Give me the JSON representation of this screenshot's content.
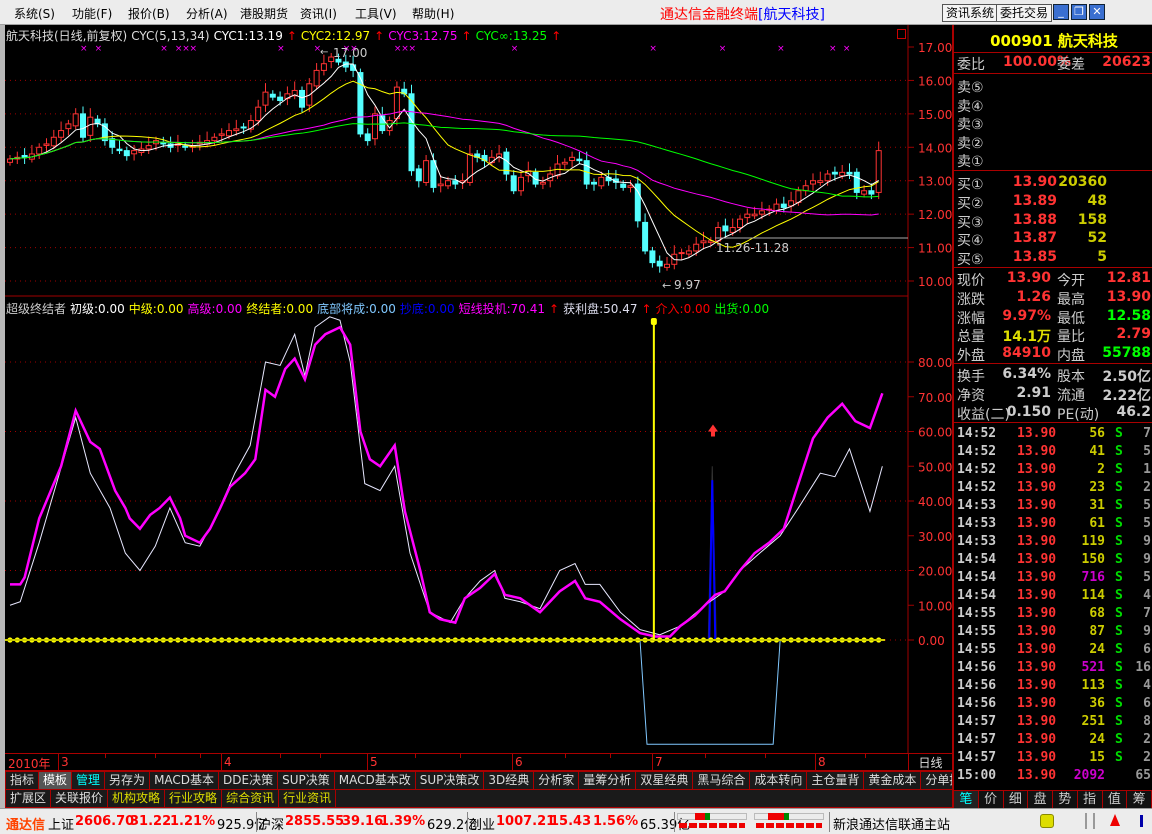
{
  "menu": [
    "系统(S)",
    "功能(F)",
    "报价(B)",
    "分析(A)",
    "港股期货",
    "资讯(I)",
    "工具(V)",
    "帮助(H)"
  ],
  "app_title": {
    "prefix": "通达信金融终端",
    "stock": "[航天科技]"
  },
  "window_buttons": {
    "info": "资讯系统",
    "trade": "委托交易",
    "minimize": "_",
    "restore": "❐",
    "close": "✕"
  },
  "price_legend": {
    "name": "航天科技(日线,前复权)",
    "indicator": "CYC(5,13,34)",
    "cyc1": "CYC1:13.19",
    "cyc2": "CYC2:12.97",
    "cyc3": "CYC3:12.75",
    "cycinf": "CYC∞:13.25",
    "arrow": "↑"
  },
  "ind_legend": {
    "name": "超级终结者",
    "chuji": "初级:0.00",
    "zhongji": "中级:0.00",
    "gaoji": "高级:0.00",
    "zhongjiezhe": "终结者:0.00",
    "dibu": "底部将成:0.00",
    "chaodi": "抄底:0.00",
    "duanxian": "短线投机:70.41",
    "huoli": "获利盘:50.47",
    "jieru": "介入:0.00",
    "chuhuo": "出货:0.00",
    "arrow": "↑"
  },
  "colors": {
    "up": "#ff3333",
    "down": "#54ffff",
    "ma5": "#ffffff",
    "ma13": "#ffff00",
    "ma34": "#ff00ff",
    "malong": "#00ff00",
    "grid": "#a00000"
  },
  "chart_data": [
    {
      "type": "candlestick",
      "title": "航天科技(日线,前复权)",
      "ylim": [
        10,
        17
      ],
      "yticks": [
        "17.00",
        "16.00",
        "15.00",
        "14.00",
        "13.00",
        "12.00",
        "11.00",
        "10.00"
      ],
      "closes": [
        13.65,
        13.7,
        13.7,
        13.8,
        14.0,
        14.1,
        14.3,
        14.5,
        14.7,
        15.0,
        14.3,
        14.9,
        14.7,
        14.2,
        14.0,
        13.9,
        13.75,
        13.9,
        13.95,
        14.05,
        14.2,
        14.1,
        14.0,
        14.1,
        14.0,
        14.05,
        14.15,
        14.2,
        14.3,
        14.4,
        14.5,
        14.55,
        14.6,
        14.8,
        15.2,
        15.65,
        15.5,
        15.4,
        15.6,
        15.7,
        15.2,
        15.9,
        16.3,
        16.5,
        16.7,
        16.55,
        16.4,
        16.3,
        14.4,
        14.2,
        15.0,
        14.5,
        14.8,
        15.8,
        15.6,
        13.3,
        13.0,
        13.6,
        12.8,
        12.9,
        13.0,
        12.9,
        13.0,
        13.8,
        13.7,
        13.6,
        13.7,
        13.8,
        13.2,
        12.7,
        13.1,
        13.3,
        12.9,
        12.95,
        13.2,
        13.5,
        13.55,
        13.7,
        13.6,
        12.9,
        12.9,
        13.1,
        13.0,
        12.95,
        12.8,
        12.85,
        11.8,
        10.9,
        10.55,
        10.45,
        10.5,
        10.8,
        10.85,
        10.9,
        11.1,
        11.2,
        11.2,
        11.6,
        11.5,
        11.6,
        11.85,
        12.0,
        12.0,
        12.1,
        12.15,
        12.3,
        12.2,
        12.4,
        12.7,
        12.85,
        13.0,
        13.0,
        13.2,
        13.2,
        13.25,
        13.2,
        12.65,
        12.7,
        12.6,
        13.9
      ],
      "ma_periods": [
        5,
        13,
        34,
        60
      ],
      "markers": [
        10,
        12,
        21,
        23,
        24,
        25,
        37,
        42,
        46,
        47,
        53,
        54,
        55,
        69,
        88,
        97.5,
        105.5,
        112.6,
        114.5
      ],
      "annotations": {
        "high": "17.00",
        "low": "9.97",
        "range": "11.26-11.28"
      }
    },
    {
      "type": "line",
      "title": "超级终结者",
      "ylim": [
        -32,
        95
      ],
      "yticks": [
        "80.00",
        "70.00",
        "60.00",
        "50.00",
        "40.00",
        "30.00",
        "20.00",
        "10.00",
        "0.00"
      ],
      "series": [
        {
          "name": "短线投机",
          "color": "#ff00ff",
          "points": [
            [
              0,
              16
            ],
            [
              1.4,
              16
            ],
            [
              2,
              18
            ],
            [
              4,
              35
            ],
            [
              7,
              50
            ],
            [
              9,
              66
            ],
            [
              11,
              57
            ],
            [
              12.3,
              55
            ],
            [
              14.4,
              43
            ],
            [
              15.8,
              38
            ],
            [
              16.4,
              35
            ],
            [
              17.8,
              32
            ],
            [
              19.2,
              36
            ],
            [
              20.5,
              38
            ],
            [
              21.9,
              41
            ],
            [
              23.3,
              35
            ],
            [
              24,
              30
            ],
            [
              26,
              28
            ],
            [
              27.4,
              32
            ],
            [
              28.8,
              38
            ],
            [
              30.1,
              44
            ],
            [
              32.2,
              48
            ],
            [
              33.6,
              52
            ],
            [
              35,
              72
            ],
            [
              36.3,
              70
            ],
            [
              37.7,
              78
            ],
            [
              39,
              81
            ],
            [
              40.4,
              75
            ],
            [
              41.8,
              85
            ],
            [
              43.2,
              88
            ],
            [
              45.2,
              90
            ],
            [
              46.6,
              85
            ],
            [
              48,
              60
            ],
            [
              49.3,
              52
            ],
            [
              50.7,
              50
            ],
            [
              52.7,
              56
            ],
            [
              54.1,
              37
            ],
            [
              56.2,
              20
            ],
            [
              57.5,
              8
            ],
            [
              58.9,
              6
            ],
            [
              61,
              5
            ],
            [
              62.3,
              12
            ],
            [
              64.4,
              15
            ],
            [
              66.4,
              19
            ],
            [
              67.8,
              13
            ],
            [
              69.9,
              12
            ],
            [
              72.6,
              8
            ],
            [
              75.3,
              14
            ],
            [
              77.4,
              17
            ],
            [
              78.8,
              12
            ],
            [
              80.8,
              11
            ],
            [
              83.6,
              6
            ],
            [
              86.3,
              2
            ],
            [
              88.4,
              1
            ],
            [
              90.4,
              1
            ],
            [
              91.8,
              4
            ],
            [
              93.8,
              7
            ],
            [
              95.2,
              10
            ],
            [
              96.6,
              13
            ],
            [
              97.9,
              14
            ],
            [
              100,
              20
            ],
            [
              102,
              25
            ],
            [
              104,
              28
            ],
            [
              106,
              32
            ],
            [
              108,
              45
            ],
            [
              110,
              58
            ],
            [
              112,
              64
            ],
            [
              114,
              68
            ],
            [
              115.8,
              63
            ],
            [
              117.8,
              61
            ],
            [
              119.5,
              71
            ]
          ]
        },
        {
          "name": "获利盘",
          "color": "#e8e8ff",
          "points": [
            [
              0,
              10
            ],
            [
              1.4,
              11
            ],
            [
              4,
              28
            ],
            [
              9,
              64
            ],
            [
              11,
              48
            ],
            [
              13.7,
              38
            ],
            [
              15.8,
              25
            ],
            [
              17.8,
              20
            ],
            [
              19.9,
              27
            ],
            [
              21.9,
              38
            ],
            [
              24,
              28
            ],
            [
              26,
              27
            ],
            [
              28.1,
              35
            ],
            [
              30.8,
              48
            ],
            [
              32.9,
              56
            ],
            [
              35,
              80
            ],
            [
              37,
              79
            ],
            [
              39,
              88
            ],
            [
              40.4,
              76
            ],
            [
              41.8,
              90
            ],
            [
              43.8,
              93
            ],
            [
              45.2,
              92
            ],
            [
              46.6,
              80
            ],
            [
              48.6,
              45
            ],
            [
              50.7,
              43
            ],
            [
              52.7,
              50
            ],
            [
              54.8,
              25
            ],
            [
              57.5,
              8
            ],
            [
              60.3,
              5
            ],
            [
              62.3,
              12
            ],
            [
              64.4,
              17
            ],
            [
              66.4,
              20
            ],
            [
              67.8,
              12
            ],
            [
              69.9,
              11
            ],
            [
              72.6,
              9
            ],
            [
              75.3,
              20
            ],
            [
              77.4,
              22
            ],
            [
              78.8,
              16
            ],
            [
              80.8,
              16
            ],
            [
              83.6,
              8
            ],
            [
              86.3,
              3
            ],
            [
              89,
              1.5
            ],
            [
              91.8,
              4
            ],
            [
              95.2,
              10
            ],
            [
              97.9,
              14
            ],
            [
              100,
              20
            ],
            [
              102.7,
              25
            ],
            [
              105.5,
              30
            ],
            [
              108,
              38
            ],
            [
              111,
              48
            ],
            [
              113,
              47
            ],
            [
              115,
              55
            ],
            [
              116.4,
              46
            ],
            [
              117.8,
              37
            ],
            [
              119.5,
              50
            ]
          ]
        }
      ],
      "signal_line_index": 88.2,
      "box": {
        "from": 86.3,
        "to": 105.5,
        "bottom": -30
      },
      "spike": {
        "index": 96.2,
        "value": 46
      },
      "arrow": {
        "index": 96.3,
        "value": 60
      }
    }
  ],
  "date_axis": {
    "year": "2010年",
    "months": [
      "3",
      "4",
      "5",
      "6",
      "7",
      "8"
    ],
    "period": "日线"
  },
  "quote": {
    "code_name": "000901 航天科技",
    "weibi_label": "委比",
    "weibi": "100.00%",
    "weicha_label": "委差",
    "weicha": "20623",
    "sell": [
      {
        "label": "卖⑤"
      },
      {
        "label": "卖④"
      },
      {
        "label": "卖③"
      },
      {
        "label": "卖②"
      },
      {
        "label": "卖①"
      }
    ],
    "buy": [
      {
        "label": "买①",
        "price": "13.90",
        "vol": "20360"
      },
      {
        "label": "买②",
        "price": "13.89",
        "vol": "48"
      },
      {
        "label": "买③",
        "price": "13.88",
        "vol": "158"
      },
      {
        "label": "买④",
        "price": "13.87",
        "vol": "52"
      },
      {
        "label": "买⑤",
        "price": "13.85",
        "vol": "5"
      }
    ],
    "stats": [
      {
        "l1": "现价",
        "v1": "13.90",
        "c1": "#ff3333",
        "l2": "今开",
        "v2": "12.81",
        "c2": "#ff3333"
      },
      {
        "l1": "涨跌",
        "v1": "1.26",
        "c1": "#ff3333",
        "l2": "最高",
        "v2": "13.90",
        "c2": "#ff3333"
      },
      {
        "l1": "涨幅",
        "v1": "9.97%",
        "c1": "#ff3333",
        "l2": "最低",
        "v2": "12.58",
        "c2": "#00ff00"
      },
      {
        "l1": "总量",
        "v1": "14.1万",
        "c1": "#e0e000",
        "l2": "量比",
        "v2": "2.79",
        "c2": "#ff3333"
      },
      {
        "l1": "外盘",
        "v1": "84910",
        "c1": "#ff3333",
        "l2": "内盘",
        "v2": "55788",
        "c2": "#00ff00"
      }
    ],
    "fin": [
      {
        "l1": "换手",
        "v1": "6.34%",
        "l2": "股本",
        "v2": "2.50亿"
      },
      {
        "l1": "净资",
        "v1": "2.91",
        "l2": "流通",
        "v2": "2.22亿"
      },
      {
        "l1": "收益(二)",
        "v1": "0.150",
        "l2": "PE(动)",
        "v2": "46.2"
      }
    ]
  },
  "ticks": [
    {
      "t": "14:52",
      "p": "13.90",
      "v": "56",
      "s": "S",
      "n": "7"
    },
    {
      "t": "14:52",
      "p": "13.90",
      "v": "41",
      "s": "S",
      "n": "5"
    },
    {
      "t": "14:52",
      "p": "13.90",
      "v": "2",
      "s": "S",
      "n": "1"
    },
    {
      "t": "14:52",
      "p": "13.90",
      "v": "23",
      "s": "S",
      "n": "2"
    },
    {
      "t": "14:53",
      "p": "13.90",
      "v": "31",
      "s": "S",
      "n": "5"
    },
    {
      "t": "14:53",
      "p": "13.90",
      "v": "61",
      "s": "S",
      "n": "5"
    },
    {
      "t": "14:53",
      "p": "13.90",
      "v": "119",
      "s": "S",
      "n": "9"
    },
    {
      "t": "14:54",
      "p": "13.90",
      "v": "150",
      "s": "S",
      "n": "9"
    },
    {
      "t": "14:54",
      "p": "13.90",
      "v": "716",
      "s": "S",
      "n": "5",
      "big": true
    },
    {
      "t": "14:54",
      "p": "13.90",
      "v": "114",
      "s": "S",
      "n": "4"
    },
    {
      "t": "14:55",
      "p": "13.90",
      "v": "68",
      "s": "S",
      "n": "7"
    },
    {
      "t": "14:55",
      "p": "13.90",
      "v": "87",
      "s": "S",
      "n": "9"
    },
    {
      "t": "14:55",
      "p": "13.90",
      "v": "24",
      "s": "S",
      "n": "6"
    },
    {
      "t": "14:56",
      "p": "13.90",
      "v": "521",
      "s": "S",
      "n": "16",
      "big": true
    },
    {
      "t": "14:56",
      "p": "13.90",
      "v": "113",
      "s": "S",
      "n": "4"
    },
    {
      "t": "14:56",
      "p": "13.90",
      "v": "36",
      "s": "S",
      "n": "6"
    },
    {
      "t": "14:57",
      "p": "13.90",
      "v": "251",
      "s": "S",
      "n": "8"
    },
    {
      "t": "14:57",
      "p": "13.90",
      "v": "24",
      "s": "S",
      "n": "2"
    },
    {
      "t": "14:57",
      "p": "13.90",
      "v": "15",
      "s": "S",
      "n": "2"
    },
    {
      "t": "15:00",
      "p": "13.90",
      "v": "2092",
      "s": "",
      "n": "65",
      "big": true
    }
  ],
  "rp_tabs": [
    "笔",
    "价",
    "细",
    "盘",
    "势",
    "指",
    "值",
    "筹"
  ],
  "tabs_row1": [
    "指标",
    "模板",
    "管理",
    "另存为",
    "MACD基本",
    "DDE决策",
    "SUP决策",
    "MACD基本改",
    "SUP决策改",
    "3D经典",
    "分析家",
    "量筹分析",
    "双星经典",
    "黑马综合",
    "成本转向",
    "主仓量背",
    "黄金成本",
    "分单持仓"
  ],
  "tabs_row2": [
    "扩展区",
    "关联报价",
    "机构攻略",
    "行业攻略",
    "综合资讯",
    "行业资讯"
  ],
  "status": {
    "brand": "通达信",
    "sh": {
      "name": "上证",
      "val": "2606.70",
      "chg": "31.22",
      "pct": "1.21%",
      "amt": "925.9亿"
    },
    "hs": {
      "name": "沪深",
      "val": "2855.55",
      "chg": "39.16",
      "pct": "1.39%",
      "amt": "629.2亿"
    },
    "cy": {
      "name": "创业",
      "val": "1007.21",
      "chg": "15.43",
      "pct": "1.56%",
      "amt": "65.39亿"
    },
    "server": "新浪通达信联通主站"
  }
}
